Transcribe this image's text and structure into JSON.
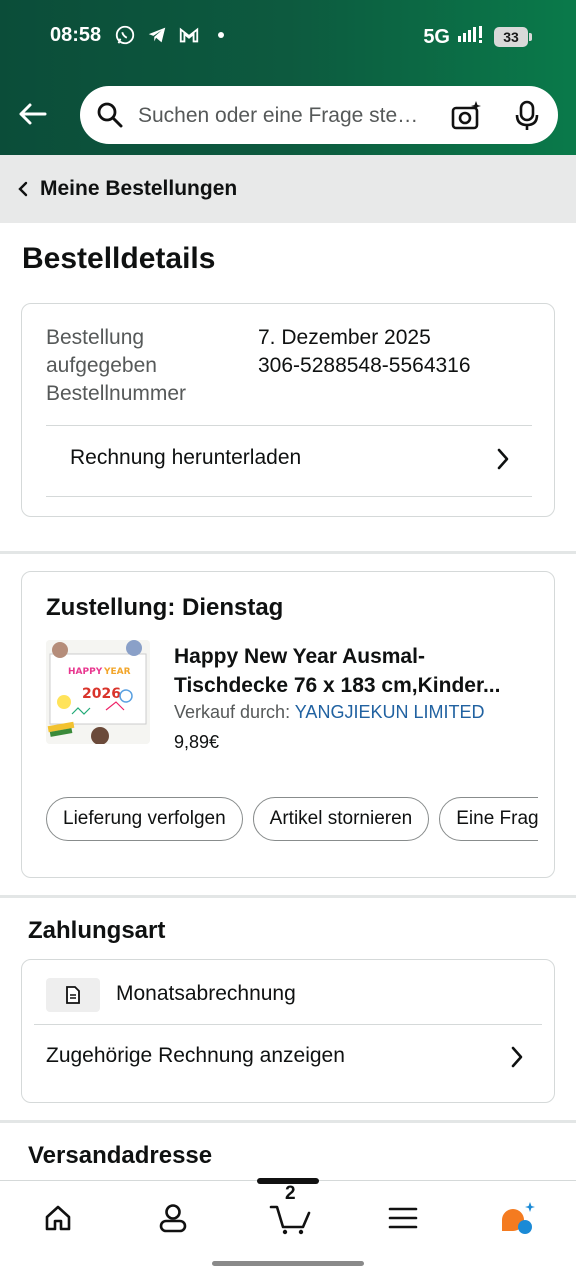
{
  "status_bar": {
    "time": "08:58",
    "network": "5G",
    "battery": "33",
    "icons": [
      "whatsapp-icon",
      "telegram-icon",
      "gmail-icon",
      "dot-icon",
      "signal-icon"
    ]
  },
  "header": {
    "search_placeholder": "Suchen oder eine Frage ste…"
  },
  "breadcrumb": {
    "label": "Meine Bestellungen"
  },
  "page_title": "Bestelldetails",
  "order_info": {
    "placed_label": "Bestellung aufgegeben",
    "number_label": "Bestellnummer",
    "placed_value": "7. Dezember 2025",
    "number_value": "306-5288548-5564316",
    "invoice_link": "Rechnung herunterladen"
  },
  "shipment": {
    "title": "Zustellung: Dienstag",
    "product_title": "Happy New Year Ausmal-Tischdecke 76 x 183 cm,Kinder...",
    "seller_prefix": "Verkauf durch:",
    "seller_name": "YANGJIEKUN LIMITED",
    "price": "9,89€",
    "thumbnail_text": "2026",
    "actions": [
      "Lieferung verfolgen",
      "Artikel stornieren",
      "Eine Frage stellen"
    ]
  },
  "payment": {
    "title": "Zahlungsart",
    "method": "Monatsabrechnung",
    "invoice_link": "Zugehörige Rechnung anzeigen"
  },
  "shipping": {
    "title": "Versandadresse"
  },
  "bottom_nav": {
    "cart_count": "2",
    "items": [
      "home-icon",
      "account-icon",
      "cart-icon",
      "menu-icon",
      "rufus-icon"
    ]
  },
  "colors": {
    "header_green": "#0b4d39",
    "link_blue": "#2162a1",
    "rufus_orange": "#f47b20",
    "rufus_blue": "#1b8ad6"
  }
}
